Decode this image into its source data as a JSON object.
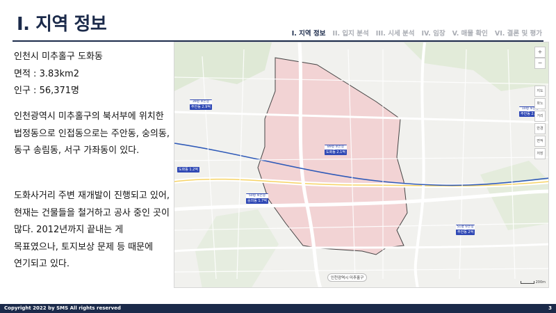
{
  "header": {
    "title": "I. 지역 정보",
    "nav": [
      {
        "label": "I. 지역 정보",
        "active": true
      },
      {
        "label": "II. 입지 분석",
        "active": false
      },
      {
        "label": "III. 시세 분석",
        "active": false
      },
      {
        "label": "IV. 임장",
        "active": false
      },
      {
        "label": "V. 매물 확인",
        "active": false
      },
      {
        "label": "VI. 결론 및 평가",
        "active": false
      }
    ]
  },
  "facts": {
    "location": "인천시 미추홀구 도화동",
    "area": "면적 : 3.83km2",
    "population": "인구 : 56,371명"
  },
  "body": {
    "p1": "인천광역시 미추홀구의 북서부에 위치한 법정동으로 인접동으로는 주안동, 숭의동, 동구 송림동, 서구 가좌동이 있다.",
    "p2": "도화사거리 주변 재개발이 진행되고 있어, 현재는 건물들을 철거하고 공사 중인 곳이 많다. 2012년까지 끝내는 게 목표였으나, 토지보상 문제 등 때문에 연기되고 있다."
  },
  "map": {
    "district_label": "인천광역시 미추홀구",
    "controls": [
      "+",
      "−",
      "지도",
      "파노",
      "거리",
      "반경",
      "면적",
      "저장"
    ],
    "bubbles": [
      {
        "tag": "39평 보는중",
        "text": "주안동 2.9억"
      },
      {
        "tag": "89평 보는중",
        "text": "도화동 2.1억"
      },
      {
        "tag": "50평 보는중",
        "text": "숭의동 1.7억"
      },
      {
        "tag": "",
        "text": "도화동 1.2억"
      },
      {
        "tag": "51평 보는중",
        "text": "주안동 2억"
      },
      {
        "tag": "10평 보는중",
        "text": "주안동 2.4억"
      }
    ],
    "colors": {
      "district_fill": "#f2c6c9",
      "road_main": "#ffffff",
      "subway": "#2f5ab8",
      "region_outline": "#444444"
    }
  },
  "footer": {
    "copyright": "Copyright 2022 by SMS All rights reserved",
    "page": "3"
  }
}
